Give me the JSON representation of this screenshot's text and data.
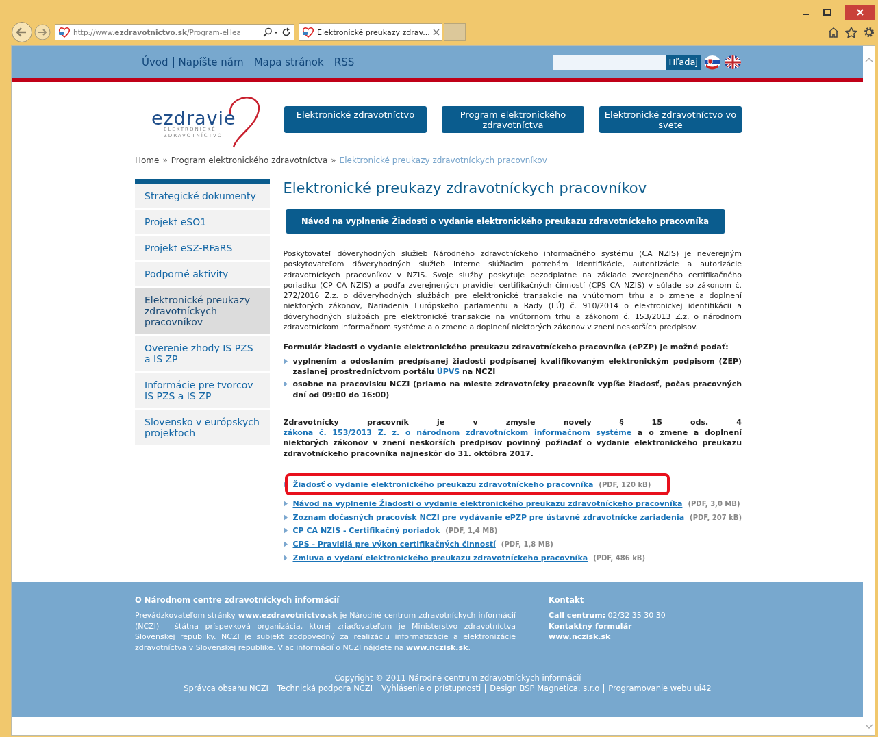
{
  "browser": {
    "address": "http://www.**ezdravotnictvo.sk**/Program-eHea",
    "tab_title": "Elektronické preukazy zdrav..."
  },
  "top_links": [
    "Úvod",
    "Napíšte nám",
    "Mapa stránok",
    "RSS"
  ],
  "search": {
    "button": "Hľadaj"
  },
  "logo": {
    "name": "ezdravie",
    "line_1": "ELEKTRONICKÉ",
    "line_2": "ZDRAVOTNÍCTVO"
  },
  "nav": [
    "Elektronické zdravotníctvo",
    "Program elektronického zdravotníctva",
    "Elektronické zdravotníctvo vo svete"
  ],
  "breadcrumb": {
    "separator": "»",
    "items": [
      {
        "label": "Home",
        "current": false
      },
      {
        "label": "Program elektronického zdravotníctva",
        "current": false
      },
      {
        "label": "Elektronické preukazy zdravotníckych pracovníkov",
        "current": true
      }
    ]
  },
  "sidebar": [
    {
      "label": "Strategické dokumenty",
      "selected": false
    },
    {
      "label": "Projekt eSO1",
      "selected": false
    },
    {
      "label": "Projekt eSZ-RFaRS",
      "selected": false
    },
    {
      "label": "Podporné aktivity",
      "selected": false
    },
    {
      "label": "Elektronické preukazy zdravotníckych pracovníkov",
      "selected": true
    },
    {
      "label": "Overenie zhody IS PZS a IS ZP",
      "selected": false
    },
    {
      "label": "Informácie pre tvorcov IS PZS a IS ZP",
      "selected": false
    },
    {
      "label": "Slovensko v európskych projektoch",
      "selected": false
    }
  ],
  "heading": "Elektronické preukazy zdravotníckych pracovníkov",
  "guide_button": "Návod na vyplnenie Žiadosti o vydanie elektronického preukazu zdravotníckeho pracovníka",
  "intro": "Poskytovateľ dôveryhodných služieb Národného zdravotníckeho informačného systému (CA NZIS) je neverejným poskytovateľom dôveryhodných služieb interne slúžiacim potrebám identifikácie, autentizácie a autorizácie zdravotníckych pracovníkov v NZIS. Svoje služby poskytuje bezodplatne na základe zverejneného certifikačného poriadku (CP CA NZIS) a podľa zverejnených pravidiel certifikačných činností (CPS CA NZIS) v súlade so zákonom č. 272/2016 Z.z. o dôveryhodných službách pre elektronické transakcie na vnútornom trhu a o zmene a doplnení niektorých zákonov, Nariadenia Európskeho parlamentu a Rady (EÚ) č. 910/2014 o elektronickej identifikácii a dôveryhodných službách pre elektronické transakcie na vnútornom trhu a zákonom č. 153/2013 Z.z. o národnom zdravotníckom informačnom systéme a o zmene a doplnení niektorých zákonov v znení neskorších predpisov.",
  "form_lead": "Formulár žiadosti o vydanie elektronického preukazu zdravotníckeho pracovníka (ePZP) je možné podať:",
  "bullets": [
    [
      {
        "text": "vyplnením a odoslaním predpísanej žiadosti podpísanej kvalifikovaným elektronickým podpisom (ZEP) zaslanej prostredníctvom portálu ",
        "link": false
      },
      {
        "text": "ÚPVS",
        "link": true
      },
      {
        "text": " na NCZI",
        "link": false
      }
    ],
    [
      {
        "text": "osobne na pracovisku NCZI (priamo na mieste zdravotnícky pracovník vypíše žiadosť, počas pracovných dní od 09:00 do 16:00)",
        "link": false
      }
    ]
  ],
  "notice": [
    {
      "text": "Zdravotnícky pracovník je v zmysle novely § 15 ods. 4 ",
      "link": false
    },
    {
      "text": "zákona č. 153/2013 Z. z. o národnom zdravotníckom ",
      "link": true
    },
    {
      "text": "informačnom systéme",
      "link": true
    },
    {
      "text": " a o zmene a doplnení niektorých zákonov v znení neskorších predpisov povinný požiadať o vydanie elektronického preukazu zdravotníckeho pracovníka najneskôr do 31. októbra 2017.",
      "link": false
    }
  ],
  "documents": [
    {
      "title": "Žiadosť o vydanie elektronického preukazu zdravotníckeho pracovníka",
      "size": "(PDF, 120 kB)",
      "highlighted": true
    },
    {
      "title": "Návod na vyplnenie Žiadosti o vydanie elektronického preukazu zdravotníckeho pracovníka",
      "size": "(PDF, 3,0 MB)",
      "highlighted": false
    },
    {
      "title": "Zoznam dočasných pracovísk NCZI pre vydávanie ePZP pre ústavné zdravotnícke zariadenia",
      "size": "(PDF, 207 kB)",
      "highlighted": false
    },
    {
      "title": "CP CA NZIS - Certifikačný poriadok",
      "size": "(PDF, 1,4 MB)",
      "highlighted": false
    },
    {
      "title": "CPS - Pravidlá pre výkon certifikačných činností",
      "size": "(PDF, 1,8 MB)",
      "highlighted": false
    },
    {
      "title": "Zmluva o vydaní elektronického preukazu zdravotníckeho pracovníka",
      "size": "(PDF, 486 kB)",
      "highlighted": false
    }
  ],
  "footer": {
    "about_title": "O Národnom centre zdravotníckych informácií",
    "about_text": "Prevádzkovateľom stránky **www.ezdravotnictvo.sk** je Národné centrum zdravotníckych informácií (NCZI) - štátna príspevková organizácia, ktorej zriaďovateľom je Ministerstvo zdravotníctva Slovenskej republiky. NCZI je subjekt zodpovedný za realizáciu informatizácie a elektronizácie zdravotníctva v Slovenskej republike. Viac informácií o NCZI nájdete na **www.nczisk.sk**.",
    "contact_title": "Kontakt",
    "contact_lines": [
      "**Call centrum:** 02/32 35 30 30",
      "**Kontaktný formulár**",
      "**www.nczisk.sk**"
    ],
    "copyright": "Copyright © 2011 Národné centrum zdravotníckych informácií",
    "links": [
      "Správca obsahu NCZI",
      "Technická podpora NCZI",
      "Vyhlásenie o prístupnosti",
      "Design BSP Magnetica, s.r.o",
      "Programovanie webu ui42"
    ]
  }
}
